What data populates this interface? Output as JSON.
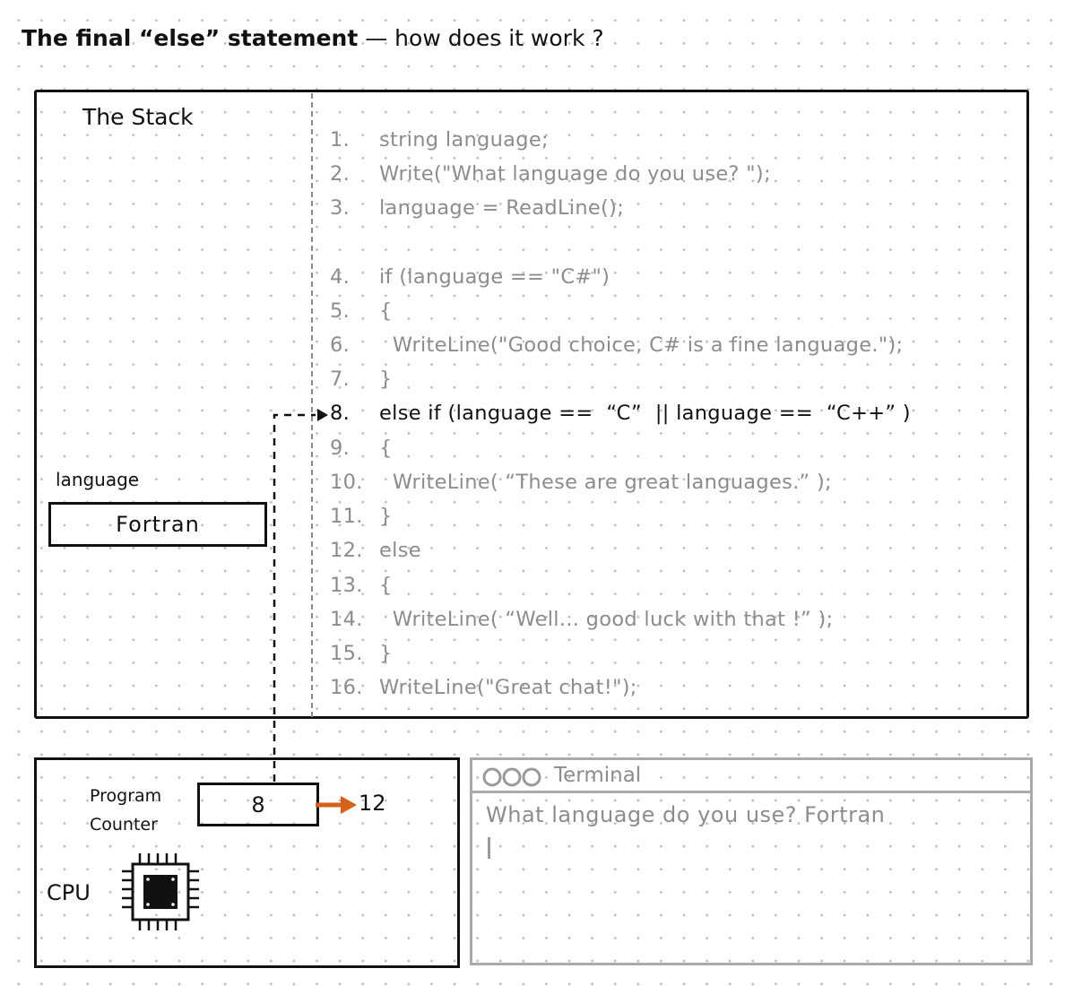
{
  "title": {
    "bold": "The final  “else” statement",
    "rest": " — how does it work ?"
  },
  "stack": {
    "title": "The Stack",
    "variable": {
      "name": "language",
      "value": "Fortran"
    }
  },
  "code": [
    {
      "num": "1.",
      "text": "string language;"
    },
    {
      "num": "2.",
      "text": "Write(\"What language do you use? \");"
    },
    {
      "num": "3.",
      "text": "language = ReadLine();"
    },
    {
      "num": "4.",
      "text": "if (language == \"C#\")"
    },
    {
      "num": "5.",
      "text": "{"
    },
    {
      "num": "6.",
      "text": "  WriteLine(\"Good choice, C# is a fine language.\");"
    },
    {
      "num": "7.",
      "text": "}"
    },
    {
      "num": "8.",
      "text": "else if (language ==  “C”  || language ==  “C++” )"
    },
    {
      "num": "9.",
      "text": "{"
    },
    {
      "num": "10.",
      "text": "  WriteLine( “These are great languages.” );"
    },
    {
      "num": "11.",
      "text": "}"
    },
    {
      "num": "12.",
      "text": "else"
    },
    {
      "num": "13.",
      "text": "{"
    },
    {
      "num": "14.",
      "text": "  WriteLine( “Well... good luck with that !” );"
    },
    {
      "num": "15.",
      "text": "}"
    },
    {
      "num": "16.",
      "text": "WriteLine(\"Great chat!\");"
    }
  ],
  "active_line": "8.",
  "cpu": {
    "label": "CPU",
    "program_counter_label_1": "Program",
    "program_counter_label_2": "Counter",
    "program_counter_value": "8",
    "next_value": "12",
    "chip_icon": "cpu-chip-icon"
  },
  "terminal": {
    "controls": "OOO",
    "title": "Terminal",
    "output": "What language do you use? Fortran"
  },
  "colors": {
    "ink": "#111111",
    "muted": "#8c8c8c",
    "arrow_orange": "#d4621a",
    "terminal_border": "#aaaaaa"
  }
}
